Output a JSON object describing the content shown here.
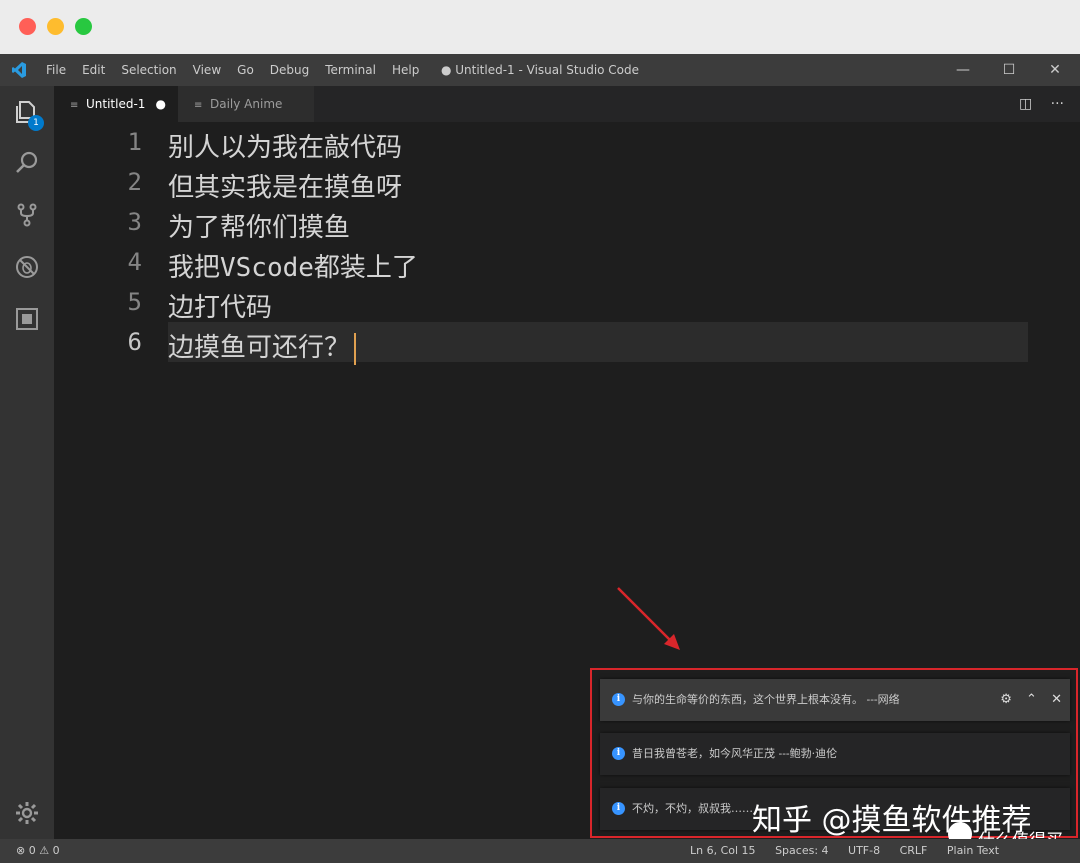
{
  "menu": [
    "File",
    "Edit",
    "Selection",
    "View",
    "Go",
    "Debug",
    "Terminal",
    "Help"
  ],
  "window_title": "● Untitled-1 - Visual Studio Code",
  "window_controls": {
    "minimize": "—",
    "maximize": "☐",
    "close": "✕"
  },
  "activity": {
    "explorer_badge": "1"
  },
  "tabs": [
    {
      "label": "Untitled-1",
      "modified": "●"
    },
    {
      "label": "Daily Anime"
    }
  ],
  "editor_actions": {
    "split": "◫",
    "more": "···"
  },
  "lines": [
    {
      "num": "1",
      "text": "别人以为我在敲代码"
    },
    {
      "num": "2",
      "text": "但其实我是在摸鱼呀"
    },
    {
      "num": "3",
      "text": "为了帮你们摸鱼"
    },
    {
      "num": "4",
      "text": "我把VScode都装上了"
    },
    {
      "num": "5",
      "text": "边打代码"
    },
    {
      "num": "6",
      "text": "边摸鱼可还行？"
    }
  ],
  "notifications": [
    {
      "text": "与你的生命等价的东西，这个世界上根本没有。 ---网络"
    },
    {
      "text": "昔日我曾苍老，如今风华正茂 ---鲍勃·迪伦"
    },
    {
      "text": "不灼，不灼，叔叔我……"
    }
  ],
  "notification_actions": {
    "settings": "⚙",
    "collapse": "⌃",
    "close": "✕"
  },
  "watermark": {
    "main": "知乎 @摸鱼软件推荐",
    "site": "什么值得买"
  },
  "status": {
    "errors": "0",
    "warnings": "0",
    "position": "Ln 6, Col 15",
    "spaces": "Spaces: 4",
    "encoding": "UTF-8",
    "eol": "CRLF",
    "language": "Plain Text"
  },
  "colors": {
    "accent": "#007acc",
    "highlight_frame": "#d9262b",
    "info": "#3794ff"
  }
}
